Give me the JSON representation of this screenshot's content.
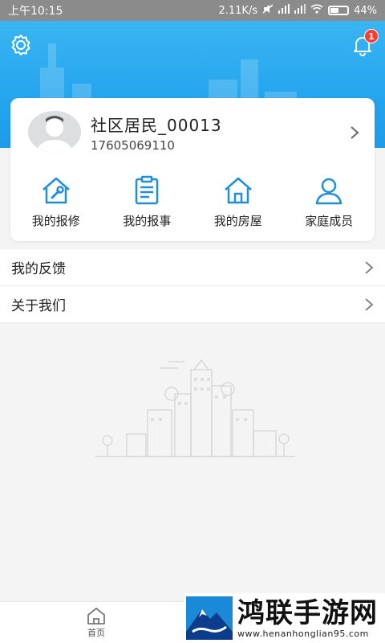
{
  "status_bar": {
    "time": "上午10:15",
    "speed": "2.11K/s",
    "battery": "44%"
  },
  "header": {
    "notification_count": "1"
  },
  "profile": {
    "name": "社区居民_00013",
    "phone": "17605069110"
  },
  "quick_actions": [
    {
      "label": "我的报修",
      "icon": "house-wrench-icon"
    },
    {
      "label": "我的报事",
      "icon": "clipboard-icon"
    },
    {
      "label": "我的房屋",
      "icon": "house-icon"
    },
    {
      "label": "家庭成员",
      "icon": "person-icon"
    }
  ],
  "menu": [
    {
      "label": "我的反馈"
    },
    {
      "label": "关于我们"
    }
  ],
  "bottom_nav": {
    "home_label": "首页"
  },
  "watermark": {
    "title": "鸿联手游网",
    "url": "www.henanhonglian95.com"
  },
  "colors": {
    "header_blue": "#25a5ee",
    "icon_blue": "#1e8fd8",
    "badge_red": "#ff3b30"
  }
}
